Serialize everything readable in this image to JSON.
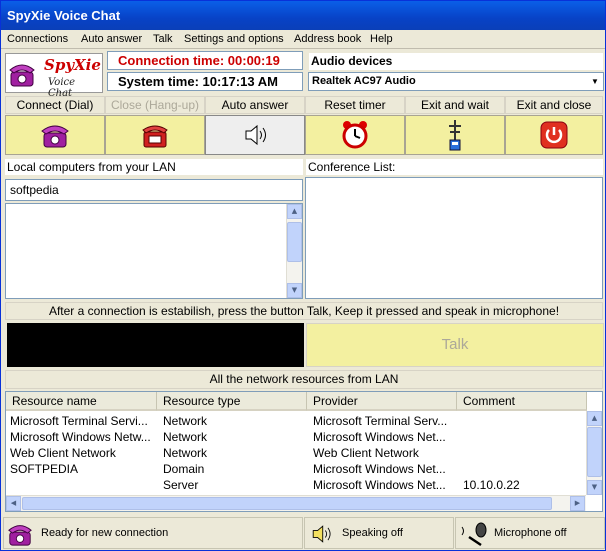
{
  "window": {
    "title": "SpyXie Voice Chat"
  },
  "menu": [
    "Connections",
    "Auto answer",
    "Talk",
    "Settings and options",
    "Address book",
    "Help"
  ],
  "logo": {
    "line1": "SpyXie",
    "line2": "Voice Chat"
  },
  "time": {
    "connection": "Connection time: 00:00:19",
    "system": "System time: 10:17:13 AM"
  },
  "audio": {
    "label": "Audio devices",
    "selected": "Realtek AC97 Audio"
  },
  "toolbar": [
    {
      "label": "Connect (Dial)",
      "icon": "phone-dial-icon",
      "enabled": true
    },
    {
      "label": "Close (Hang-up)",
      "icon": "phone-hangup-icon",
      "enabled": false
    },
    {
      "label": "Auto answer",
      "icon": "speaker-icon",
      "enabled": true
    },
    {
      "label": "Reset timer",
      "icon": "alarm-clock-icon",
      "enabled": true
    },
    {
      "label": "Exit and wait",
      "icon": "antenna-icon",
      "enabled": true
    },
    {
      "label": "Exit and close",
      "icon": "power-icon",
      "enabled": true
    }
  ],
  "lan": {
    "label": "Local computers from your LAN",
    "input_value": "softpedia"
  },
  "conference": {
    "label": "Conference List:"
  },
  "hint": "After a connection is estabilish, press the button Talk, Keep it pressed and speak in microphone!",
  "talk": {
    "label": "Talk"
  },
  "network": {
    "title": "All the network resources from LAN",
    "columns": [
      "Resource name",
      "Resource type",
      "Provider",
      "Comment"
    ],
    "rows": [
      [
        "Microsoft Terminal Servi...",
        "Network",
        "Microsoft Terminal Serv...",
        ""
      ],
      [
        "Microsoft Windows Netw...",
        "Network",
        "Microsoft Windows Net...",
        ""
      ],
      [
        "Web Client Network",
        "Network",
        "Web Client Network",
        ""
      ],
      [
        "SOFTPEDIA",
        "Domain",
        "Microsoft Windows Net...",
        ""
      ],
      [
        "",
        "Server",
        "Microsoft Windows Net...",
        "10.10.0.22"
      ]
    ]
  },
  "status": {
    "connection": "Ready for new connection",
    "speaking": "Speaking off",
    "microphone": "Microphone off"
  },
  "colors": {
    "title_bar": "#0842c6",
    "button_face": "#f3f0a0",
    "connection_time": "#cc0000"
  }
}
